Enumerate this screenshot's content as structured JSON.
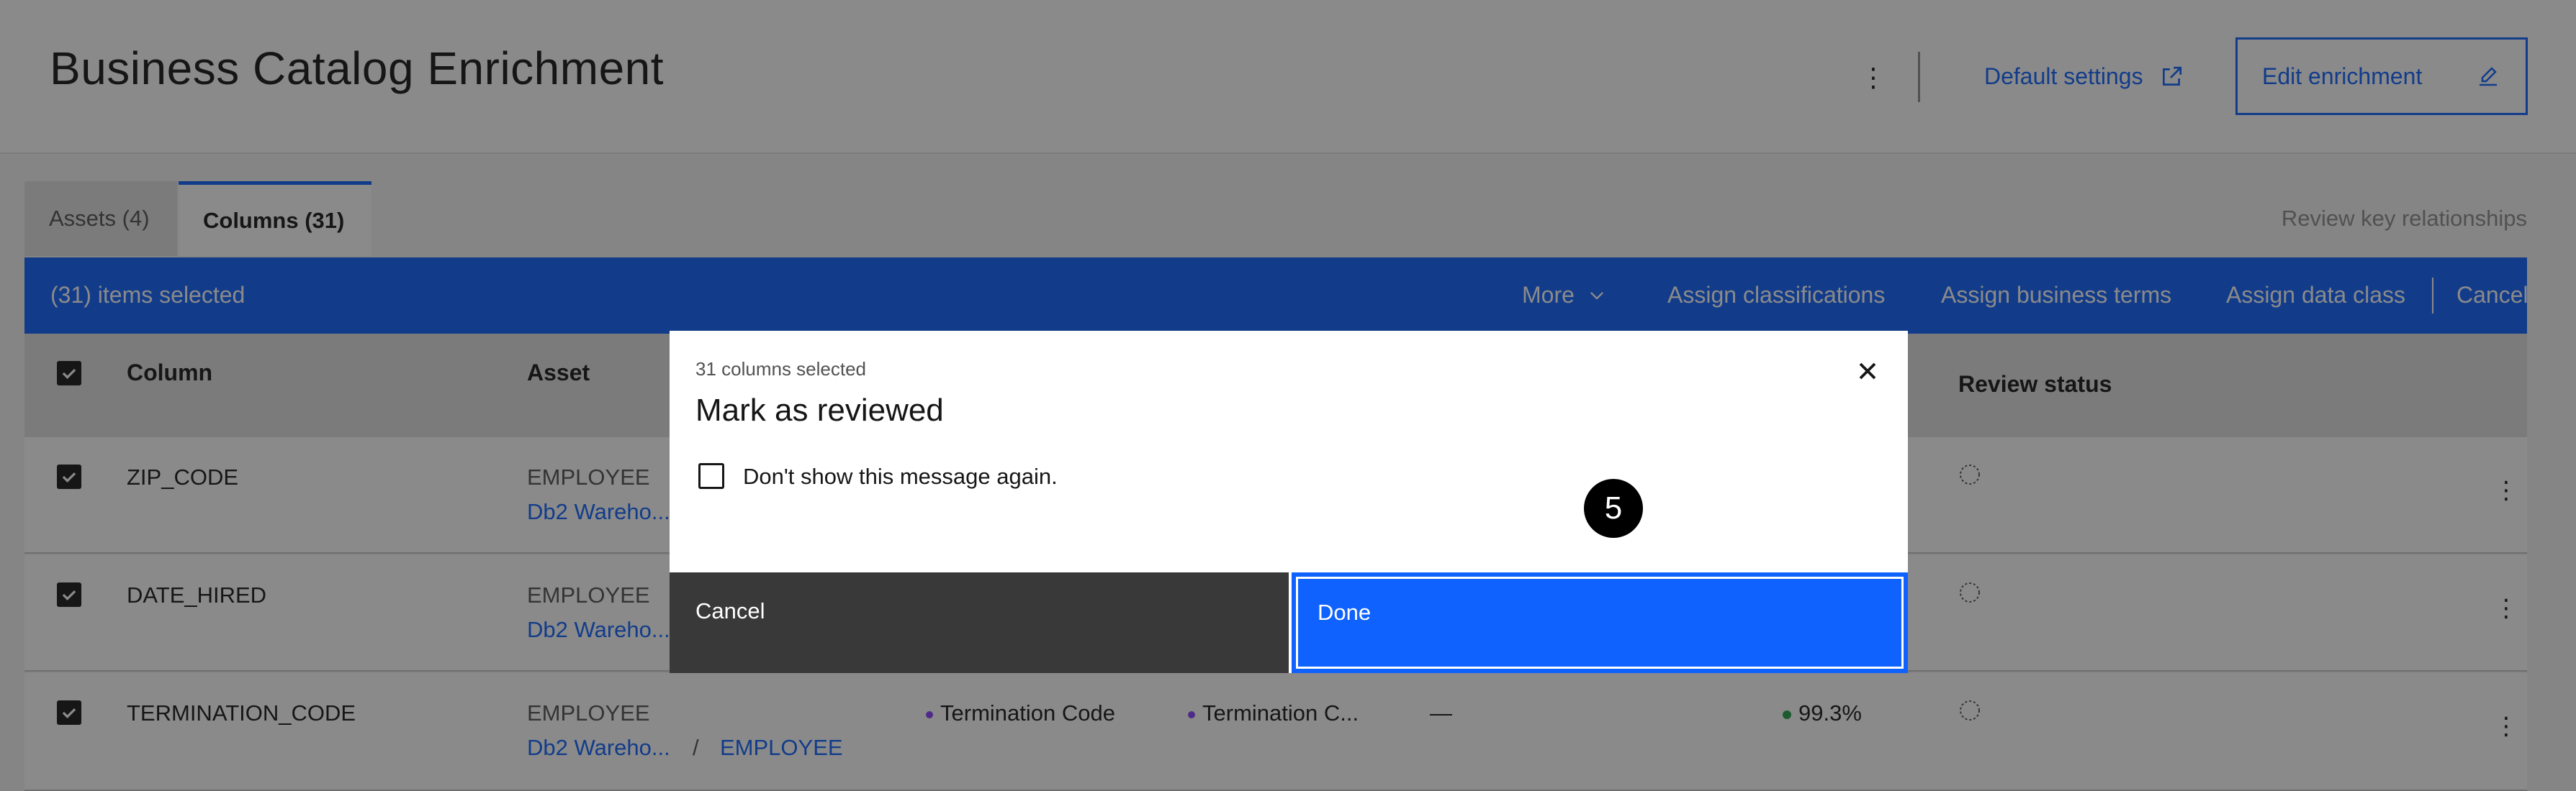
{
  "header": {
    "title": "Business Catalog Enrichment",
    "default_settings": "Default settings",
    "edit_enrichment": "Edit enrichment"
  },
  "tabs": [
    {
      "label": "Assets (4)"
    },
    {
      "label": "Columns (31)"
    }
  ],
  "review_key": "Review key relationships",
  "batch_bar": {
    "count": "(31) items selected",
    "more": "More",
    "assign_classifications": "Assign classifications",
    "assign_business_terms": "Assign business terms",
    "assign_data_class": "Assign data class",
    "cancel": "Cancel"
  },
  "table": {
    "headers": {
      "column": "Column",
      "asset": "Asset",
      "review_status": "Review status"
    },
    "rows": [
      {
        "column": "ZIP_CODE",
        "asset": "EMPLOYEE",
        "path": "Db2 Wareho...",
        "sep": "",
        "path_table": "",
        "term": "",
        "class": "",
        "dash": "",
        "score": ""
      },
      {
        "column": "DATE_HIRED",
        "asset": "EMPLOYEE",
        "path": "Db2 Wareho...",
        "sep": "",
        "path_table": "",
        "term": "",
        "class": "",
        "dash": "",
        "score": ""
      },
      {
        "column": "TERMINATION_CODE",
        "asset": "EMPLOYEE",
        "path": "Db2 Wareho...",
        "sep": "/",
        "path_table": "EMPLOYEE",
        "term": "Termination Code",
        "class": "Termination C...",
        "dash": "—",
        "score": "99.3%"
      }
    ]
  },
  "modal": {
    "label": "31 columns selected",
    "title": "Mark as reviewed",
    "checkbox_label": "Don't show this message again.",
    "cancel": "Cancel",
    "done": "Done",
    "step": "5"
  }
}
